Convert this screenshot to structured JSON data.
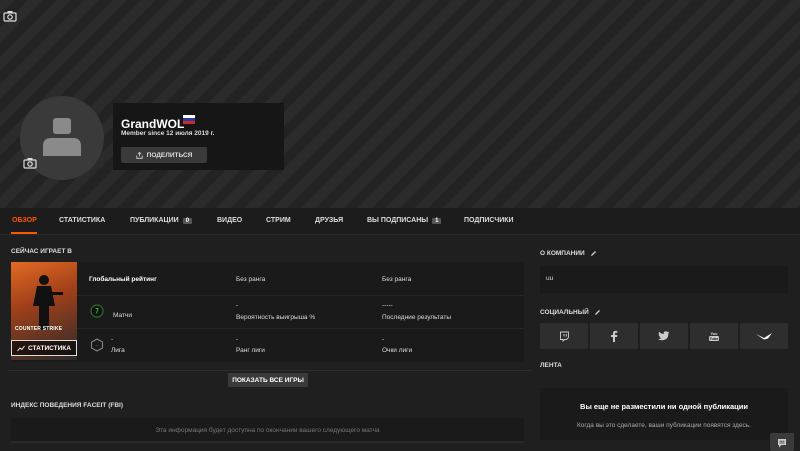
{
  "profile": {
    "username": "GrandWOL",
    "member_since": "Member since 12 июля 2019 г.",
    "share_label": "ПОДЕЛИТЬСЯ",
    "country_flag": "russia-flag-icon"
  },
  "tabs": [
    {
      "label": "ОБЗОР",
      "active": true
    },
    {
      "label": "СТАТИСТИКА"
    },
    {
      "label": "ПУБЛИКАЦИИ",
      "badge": "0"
    },
    {
      "label": "ВИДЕО"
    },
    {
      "label": "СТРИМ"
    },
    {
      "label": "ДРУЗЬЯ"
    },
    {
      "label": "ВЫ ПОДПИСАНЫ",
      "badge": "1"
    },
    {
      "label": "ПОДПИСЧИКИ"
    }
  ],
  "now_playing": {
    "title": "СЕЙЧАС ИГРАЕТ В",
    "game_logo": "COUNTER STRIKE",
    "stats_button": "СТАТИСТИКА",
    "global_rating_label": "Глобальный рейтинг",
    "rank1": "Без ранга",
    "rank2": "Без ранга",
    "matches_label": "Матчи",
    "win_prob_value": "-",
    "win_prob_label": "Вероятность выигрыша %",
    "last_results_value": "-----",
    "last_results_label": "Последние результаты",
    "league_value": "-",
    "league_label": "Лига",
    "league_rank_value": "-",
    "league_rank_label": "Ранг лиги",
    "league_points_value": "-",
    "league_points_label": "Очки лиги",
    "show_all": "ПОКАЗАТЬ ВСЕ ИГРЫ"
  },
  "fbi": {
    "title": "ИНДЕКС ПОВЕДЕНИЯ FACEIT (FBI)",
    "text": "Эта информация будет доступна по окончании вашего следующего матча"
  },
  "about": {
    "title": "О КОМПАНИИ",
    "text": "uu"
  },
  "social": {
    "title": "СОЦИАЛЬНЫЙ",
    "icons": [
      "twitch-icon",
      "facebook-icon",
      "twitter-icon",
      "youtube-icon",
      "steam-icon"
    ]
  },
  "feed": {
    "title": "ЛЕНТА",
    "empty_title": "Вы еще не разместили ни одной публикации",
    "empty_sub": "Когда вы это сделаете, ваши публикации появятся здесь."
  },
  "colors": {
    "accent": "#ff5500",
    "background": "#1f1f1f"
  }
}
